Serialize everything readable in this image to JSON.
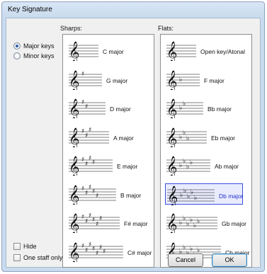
{
  "window": {
    "title": "Key Signature"
  },
  "mode": {
    "options": [
      {
        "label": "Major keys",
        "checked": true
      },
      {
        "label": "Minor keys",
        "checked": false
      }
    ]
  },
  "sharps": {
    "label": "Sharps:",
    "items": [
      {
        "label": "C major",
        "accidentals": 0
      },
      {
        "label": "G major",
        "accidentals": 1
      },
      {
        "label": "D major",
        "accidentals": 2
      },
      {
        "label": "A major",
        "accidentals": 3
      },
      {
        "label": "E major",
        "accidentals": 4
      },
      {
        "label": "B major",
        "accidentals": 5
      },
      {
        "label": "F# major",
        "accidentals": 6
      },
      {
        "label": "C# major",
        "accidentals": 7
      }
    ]
  },
  "flats": {
    "label": "Flats:",
    "items": [
      {
        "label": "Open key/Atonal",
        "accidentals": 0,
        "selected": false
      },
      {
        "label": "F major",
        "accidentals": 1,
        "selected": false
      },
      {
        "label": "Bb major",
        "accidentals": 2,
        "selected": false
      },
      {
        "label": "Eb major",
        "accidentals": 3,
        "selected": false
      },
      {
        "label": "Ab major",
        "accidentals": 4,
        "selected": false
      },
      {
        "label": "Db major",
        "accidentals": 5,
        "selected": true
      },
      {
        "label": "Gb major",
        "accidentals": 6,
        "selected": false
      },
      {
        "label": "Cb major",
        "accidentals": 7,
        "selected": false
      }
    ]
  },
  "options": {
    "hide": {
      "label": "Hide",
      "checked": false
    },
    "one_staff": {
      "label": "One staff only",
      "checked": false
    }
  },
  "buttons": {
    "cancel": "Cancel",
    "ok": "OK"
  },
  "colors": {
    "selection_border": "#3a4fe0",
    "selection_text": "#2633c9"
  }
}
